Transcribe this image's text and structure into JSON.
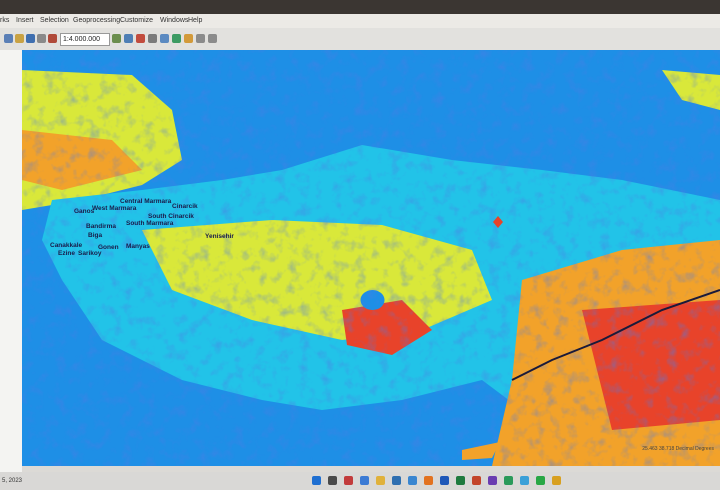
{
  "menu": [
    "Insert",
    "Selection",
    "Geoprocessing",
    "Customize",
    "Windows",
    "Help"
  ],
  "toolbar": {
    "scale": "1:4.000.000"
  },
  "map_labels": [
    "Central Marmara",
    "West Marmara",
    "Cinarcik",
    "Ganos",
    "South Cinarcik",
    "South Marmara",
    "Bandirma",
    "Yenisehir",
    "Biga",
    "Canakkale",
    "Gonen",
    "Manyas",
    "Ezine",
    "Sarikoy"
  ],
  "status": {
    "coordinates": "25.463 38.718 Decimal Degrees"
  },
  "taskbar": {
    "date": "5, 2023"
  },
  "colors": {
    "sea": "#1e8fe6",
    "low": "#1633c8",
    "mid": "#22c3e8",
    "mid2": "#d9e83a",
    "high": "#f2a22a",
    "peak": "#e8432a"
  }
}
